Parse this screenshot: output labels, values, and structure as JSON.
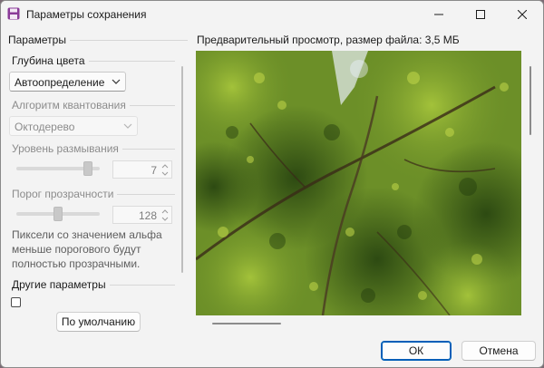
{
  "window": {
    "title": "Параметры сохранения"
  },
  "left": {
    "section_title": "Параметры",
    "color_depth": {
      "label": "Глубина цвета",
      "value": "Автоопределение"
    },
    "quantization": {
      "label": "Алгоритм квантования",
      "value": "Октодерево"
    },
    "blur": {
      "label": "Уровень размывания",
      "value": "7",
      "slider_fraction": 0.88
    },
    "transparency": {
      "label": "Порог прозрачности",
      "value": "128",
      "slider_fraction": 0.5
    },
    "help_text": "Пиксели со значением альфа меньше порогового будут полностью прозрачными.",
    "other_title": "Другие параметры",
    "defaults_button": "По умолчанию"
  },
  "preview": {
    "label": "Предварительный просмотр, размер файла: 3,5 МБ"
  },
  "footer": {
    "ok": "ОК",
    "cancel": "Отмена"
  },
  "colors": {
    "accent": "#005fb8",
    "icon": "#8a3a98",
    "foliage": "#6c8f28",
    "sky": "#e8eef5"
  }
}
